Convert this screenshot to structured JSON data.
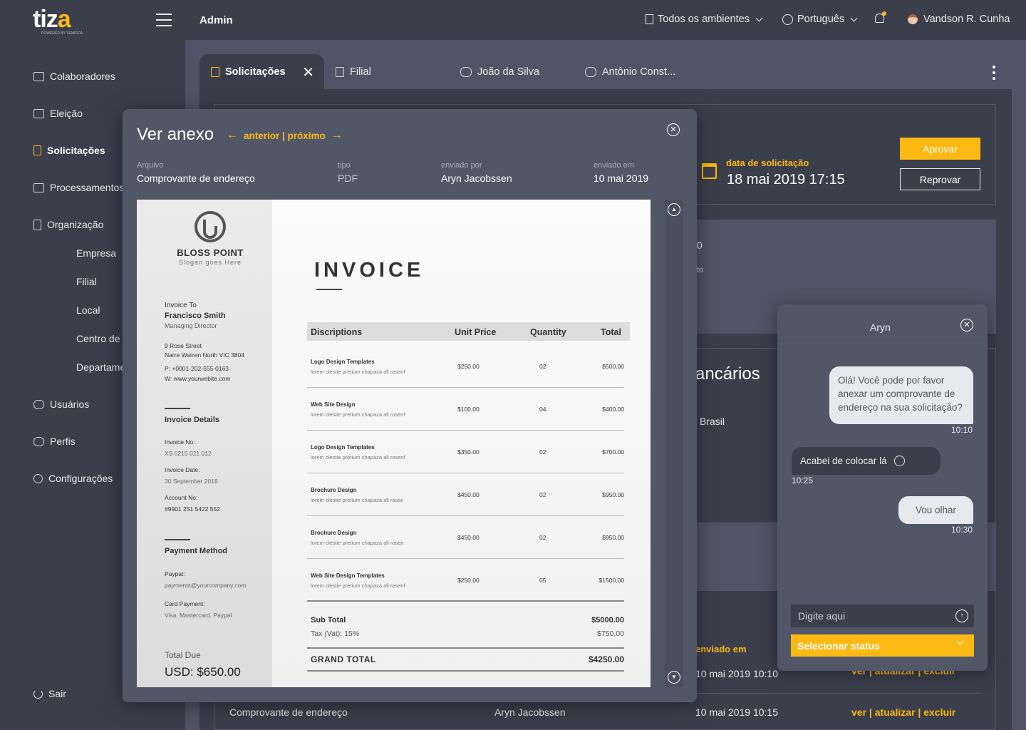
{
  "app": {
    "logo": "tiza",
    "logo_sub": "POWERED BY SEMIÓDA",
    "section": "Admin"
  },
  "topbar": {
    "environments": "Todos os ambientes",
    "language": "Português",
    "user": "Vandson R. Cunha"
  },
  "sidebar": {
    "items": [
      "Colaboradores",
      "Eleição",
      "Solicitações",
      "Processamentos",
      "Organização"
    ],
    "sub": [
      "Empresa",
      "Filial",
      "Local",
      "Centro de",
      "Departame"
    ],
    "items2": [
      "Usuários",
      "Perfis",
      "Configurações"
    ],
    "logout": "Sair"
  },
  "tabs": [
    "Solicitações",
    "Filial",
    "João da Silva",
    "Antônio Const..."
  ],
  "request": {
    "date_label": "data de solicitação",
    "date_value": "18 mai 2019 17:15",
    "approve": "Aprovar",
    "reject": "Reprovar",
    "partial1": "0",
    "partial2": "to",
    "bank_title": "ancários",
    "country": "Brasil",
    "sent_col": "enviado em",
    "row1_date": "10 mai 2019 10:10",
    "row1_actions": "ver | atualizar | excluir",
    "row2_file": "Comprovante de endereço",
    "row2_sender": "Aryn Jacobssen",
    "row2_date": "10 mai 2019 10:15",
    "row2_actions": "ver | atualizar | excluir"
  },
  "modal": {
    "title": "Ver anexo",
    "nav": "anterior | próximo",
    "file_label": "Arquivo",
    "file_value": "Comprovante de endereço",
    "type_label": "tipo",
    "type_value": "PDF",
    "sender_label": "enviado por",
    "sender_value": "Aryn Jacobssen",
    "sent_label": "enviado em",
    "sent_value": "10 mai 2019"
  },
  "invoice": {
    "company": "BLOSS POINT",
    "slogan": "Slogan goes Here",
    "title": "INVOICE",
    "to_label": "Invoice To",
    "to_name": "Francisco Smith",
    "to_role": "Managing Director",
    "addr1": "9 Rose Street",
    "addr2": "Narre Warren North VIC 3804",
    "phone": "P: +0001-202-555-0163",
    "web": "W: www.yourwebite.com",
    "details_label": "Invoice Details",
    "no_label": "Invoice No:",
    "no_value": "XS 0215 021 012",
    "date_label": "Invoice Date:",
    "date_value": "30 September 2018",
    "acct_label": "Account No:",
    "acct_value": "#9901 251 5422 552",
    "pay_label": "Payment Method",
    "paypal_label": "Paypal:",
    "paypal_value": "payments@yourcompany.com",
    "card_label": "Card Payment:",
    "card_value": "Visa, Mastercard, Paypal",
    "due_label": "Total Due",
    "due_value": "USD: $650.00",
    "headers": [
      "Discriptions",
      "Unit Price",
      "Quantity",
      "Total"
    ],
    "rows": [
      {
        "name": "Logo Design Templates",
        "desc": "lorem olestie pretium chapaza all rosenf",
        "price": "$250.00",
        "qty": "02",
        "total": "$500.00"
      },
      {
        "name": "Web Site Design",
        "desc": "lorem olestie pretium chapaza all rosenf",
        "price": "$100.00",
        "qty": "04",
        "total": "$400.00"
      },
      {
        "name": "Logo Design Templates",
        "desc": "lorem olestie pretium chapaza all rosenf",
        "price": "$350.00",
        "qty": "02",
        "total": "$700.00"
      },
      {
        "name": "Brochure Design",
        "desc": "lorem olestie pretium chapaza all rosen",
        "price": "$450.00",
        "qty": "02",
        "total": "$950.00"
      },
      {
        "name": "Brochure Design",
        "desc": "lorem olestie pretium chapaza all rosen",
        "price": "$450.00",
        "qty": "02",
        "total": "$950.00"
      },
      {
        "name": "Web Site Design Templates",
        "desc": "lorem olestie pretium chapaza all rosenf",
        "price": "$250.00",
        "qty": "05",
        "total": "$1500.00"
      }
    ],
    "subtotal_label": "Sub Total",
    "subtotal_value": "$5000.00",
    "tax_label": "Tax (Vat): 15%",
    "tax_value": "$750.00",
    "grand_label": "GRAND TOTAL",
    "grand_value": "$4250.00"
  },
  "chat": {
    "title": "Aryn",
    "messages": [
      {
        "text": "Olá! Você pode por favor anexar um comprovante de endereço na sua solicitação?",
        "time": "10:10"
      },
      {
        "text": "Acabei de colocar lá",
        "time": "10:25"
      },
      {
        "text": "Vou olhar",
        "time": "10:30"
      }
    ],
    "input_placeholder": "Digite aqui",
    "status_label": "Selecionar status"
  },
  "colors": {
    "accent": "#fdb913",
    "bg": "#3b3f4c",
    "content": "#4f5466"
  }
}
